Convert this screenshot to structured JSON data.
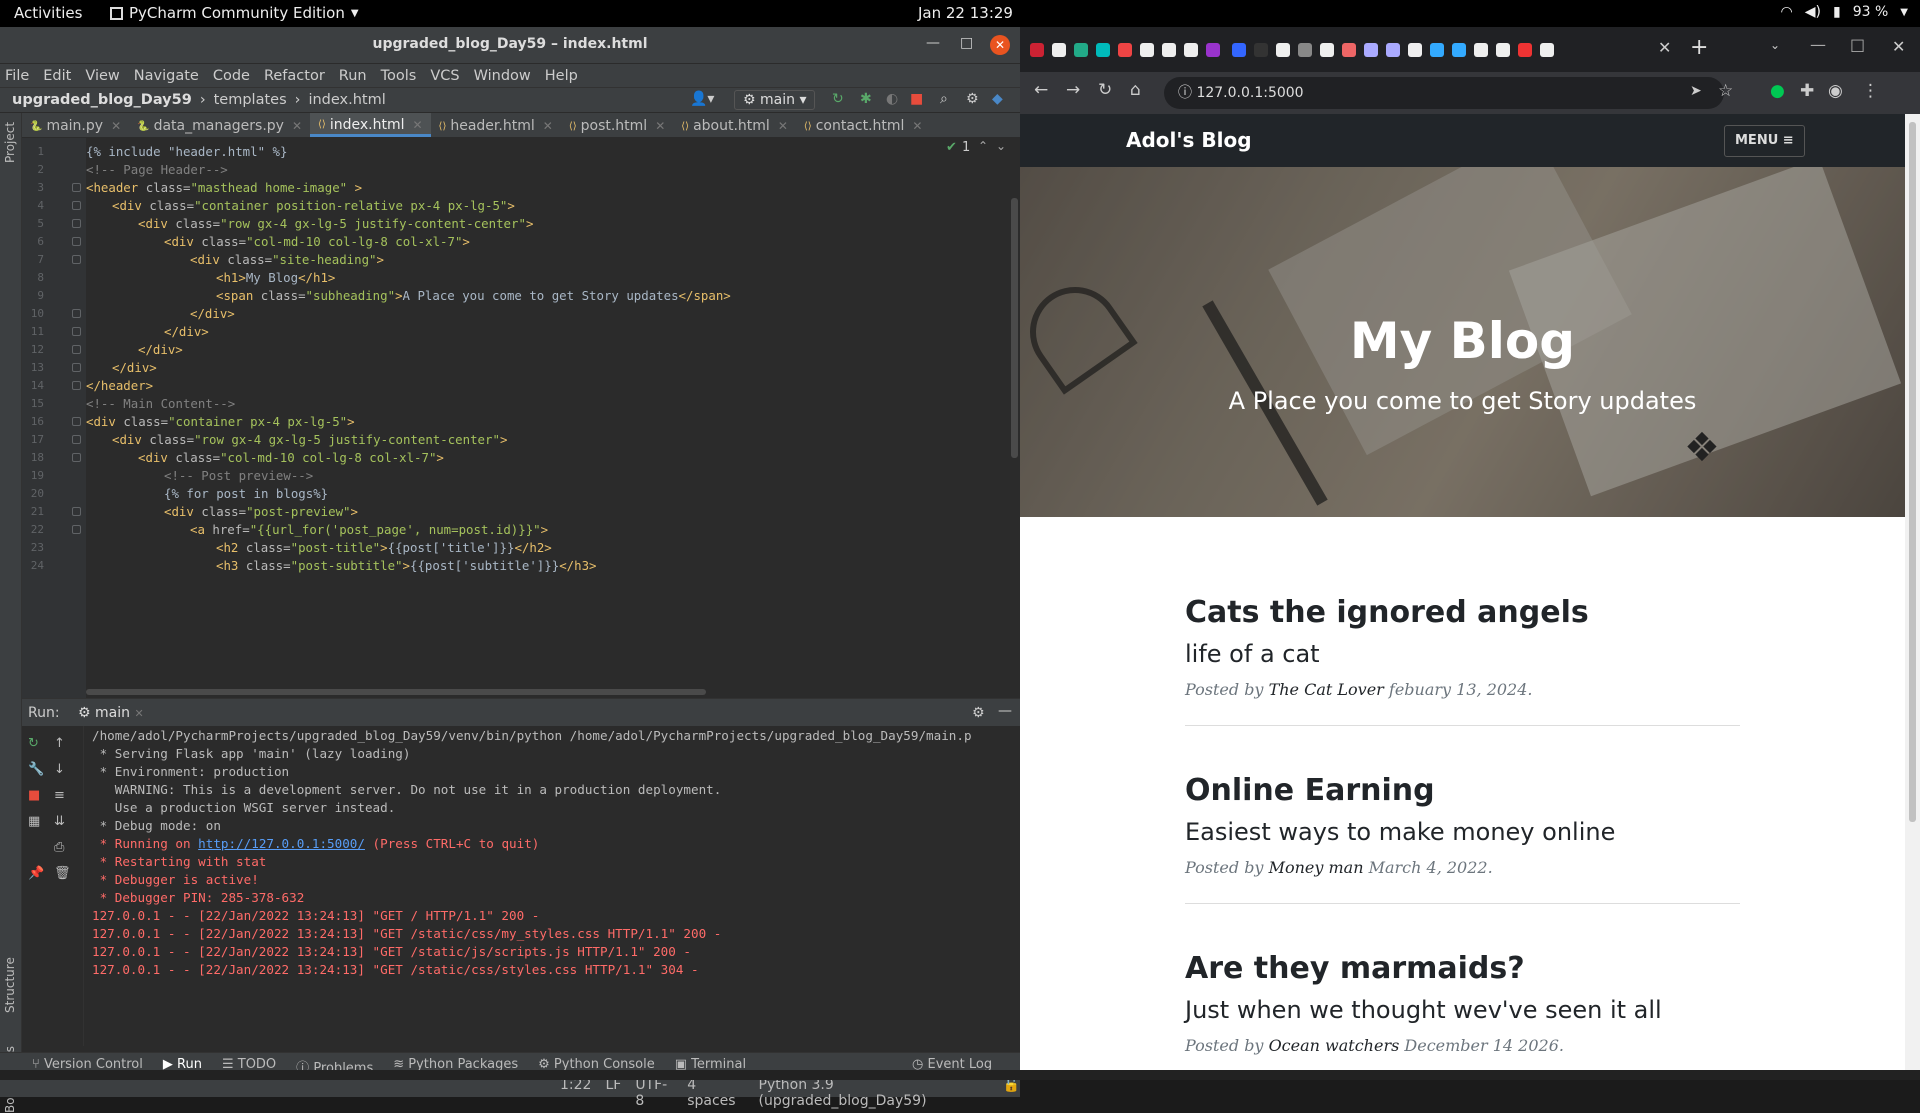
{
  "topbar": {
    "activities": "Activities",
    "app_name": "PyCharm Community Edition",
    "clock": "Jan 22  13:29",
    "battery": "93 %"
  },
  "pycharm": {
    "title": "upgraded_blog_Day59 – index.html",
    "menu": [
      "File",
      "Edit",
      "View",
      "Navigate",
      "Code",
      "Refactor",
      "Run",
      "Tools",
      "VCS",
      "Window",
      "Help"
    ],
    "breadcrumb": {
      "project": "upgraded_blog_Day59",
      "folder": "templates",
      "file": "index.html"
    },
    "branch": "main",
    "tabs": [
      "main.py",
      "data_managers.py",
      "index.html",
      "header.html",
      "post.html",
      "about.html",
      "contact.html"
    ],
    "active_tab": "index.html",
    "project_label": "Project",
    "inspection": "1",
    "code_lines": [
      {
        "n": "1",
        "indent": 0,
        "parts": [
          [
            "t",
            "{% include \"header.html\" %}"
          ]
        ]
      },
      {
        "n": "2",
        "indent": 2,
        "parts": [
          [
            "c",
            "<!-- Page Header-->"
          ]
        ]
      },
      {
        "n": "3",
        "indent": 2,
        "parts": [
          [
            "g",
            "<header "
          ],
          [
            "a",
            "class="
          ],
          [
            "s",
            "\"masthead home-image\""
          ],
          [
            "g",
            " >"
          ]
        ]
      },
      {
        "n": "4",
        "indent": 3,
        "parts": [
          [
            "g",
            "<div "
          ],
          [
            "a",
            "class="
          ],
          [
            "s",
            "\"container position-relative px-4 px-lg-5\""
          ],
          [
            "g",
            ">"
          ]
        ]
      },
      {
        "n": "5",
        "indent": 4,
        "parts": [
          [
            "g",
            "<div "
          ],
          [
            "a",
            "class="
          ],
          [
            "s",
            "\"row gx-4 gx-lg-5 justify-content-center\""
          ],
          [
            "g",
            ">"
          ]
        ]
      },
      {
        "n": "6",
        "indent": 5,
        "parts": [
          [
            "g",
            "<div "
          ],
          [
            "a",
            "class="
          ],
          [
            "s",
            "\"col-md-10 col-lg-8 col-xl-7\""
          ],
          [
            "g",
            ">"
          ]
        ]
      },
      {
        "n": "7",
        "indent": 6,
        "parts": [
          [
            "g",
            "<div "
          ],
          [
            "a",
            "class="
          ],
          [
            "s",
            "\"site-heading\""
          ],
          [
            "g",
            ">"
          ]
        ]
      },
      {
        "n": "8",
        "indent": 7,
        "parts": [
          [
            "g",
            "<h1>"
          ],
          [
            "t",
            "My Blog"
          ],
          [
            "g",
            "</h1>"
          ]
        ]
      },
      {
        "n": "9",
        "indent": 7,
        "parts": [
          [
            "g",
            "<span "
          ],
          [
            "a",
            "class="
          ],
          [
            "s",
            "\"subheading\""
          ],
          [
            "g",
            ">"
          ],
          [
            "t",
            "A Place you come to get Story updates"
          ],
          [
            "g",
            "</span>"
          ]
        ]
      },
      {
        "n": "10",
        "indent": 6,
        "parts": [
          [
            "g",
            "</div>"
          ]
        ]
      },
      {
        "n": "11",
        "indent": 5,
        "parts": [
          [
            "g",
            "</div>"
          ]
        ]
      },
      {
        "n": "12",
        "indent": 4,
        "parts": [
          [
            "g",
            "</div>"
          ]
        ]
      },
      {
        "n": "13",
        "indent": 3,
        "parts": [
          [
            "g",
            "</div>"
          ]
        ]
      },
      {
        "n": "14",
        "indent": 2,
        "parts": [
          [
            "g",
            "</header>"
          ]
        ]
      },
      {
        "n": "15",
        "indent": 2,
        "parts": [
          [
            "c",
            "<!-- Main Content-->"
          ]
        ]
      },
      {
        "n": "16",
        "indent": 2,
        "parts": [
          [
            "g",
            "<div "
          ],
          [
            "a",
            "class="
          ],
          [
            "s",
            "\"container px-4 px-lg-5\""
          ],
          [
            "g",
            ">"
          ]
        ]
      },
      {
        "n": "17",
        "indent": 3,
        "parts": [
          [
            "g",
            "<div "
          ],
          [
            "a",
            "class="
          ],
          [
            "s",
            "\"row gx-4 gx-lg-5 justify-content-center\""
          ],
          [
            "g",
            ">"
          ]
        ]
      },
      {
        "n": "18",
        "indent": 4,
        "parts": [
          [
            "g",
            "<div "
          ],
          [
            "a",
            "class="
          ],
          [
            "s",
            "\"col-md-10 col-lg-8 col-xl-7\""
          ],
          [
            "g",
            ">"
          ]
        ]
      },
      {
        "n": "19",
        "indent": 5,
        "parts": [
          [
            "c",
            "<!-- Post preview-->"
          ]
        ]
      },
      {
        "n": "20",
        "indent": 5,
        "parts": [
          [
            "t",
            "{% for post in blogs%}"
          ]
        ]
      },
      {
        "n": "21",
        "indent": 5,
        "parts": [
          [
            "g",
            "<div "
          ],
          [
            "a",
            "class="
          ],
          [
            "s",
            "\"post-preview\""
          ],
          [
            "g",
            ">"
          ]
        ]
      },
      {
        "n": "22",
        "indent": 6,
        "parts": [
          [
            "g",
            "<a "
          ],
          [
            "a",
            "href="
          ],
          [
            "s",
            "\"{{url_for('post_page', num=post.id)}}\""
          ],
          [
            "g",
            ">"
          ]
        ]
      },
      {
        "n": "23",
        "indent": 7,
        "parts": [
          [
            "g",
            "<h2 "
          ],
          [
            "a",
            "class="
          ],
          [
            "s",
            "\"post-title\""
          ],
          [
            "g",
            ">"
          ],
          [
            "t",
            "{{post['title']}}"
          ],
          [
            "g",
            "</h2>"
          ]
        ]
      },
      {
        "n": "24",
        "indent": 7,
        "parts": [
          [
            "g",
            "<h3 "
          ],
          [
            "a",
            "class="
          ],
          [
            "s",
            "\"post-subtitle\""
          ],
          [
            "g",
            ">"
          ],
          [
            "t",
            "{{post['subtitle']}}"
          ],
          [
            "g",
            "</h3>"
          ]
        ]
      }
    ],
    "run": {
      "label": "Run:",
      "config": "main",
      "lines": [
        {
          "text": "/home/adol/PycharmProjects/upgraded_blog_Day59/venv/bin/python /home/adol/PycharmProjects/upgraded_blog_Day59/main.p",
          "color": "#bbbbbb"
        },
        {
          "text": " * Serving Flask app 'main' (lazy loading)",
          "color": "#bbbbbb"
        },
        {
          "text": " * Environment: production",
          "color": "#bbbbbb"
        },
        {
          "text": "   WARNING: This is a development server. Do not use it in a production deployment.",
          "color": "#bbbbbb"
        },
        {
          "text": "   Use a production WSGI server instead.",
          "color": "#bbbbbb"
        },
        {
          "text": " * Debug mode: on",
          "color": "#bbbbbb"
        },
        {
          "text": " * Running on ",
          "color": "#ff6b68",
          "link": "http://127.0.0.1:5000/",
          "after": " (Press CTRL+C to quit)"
        },
        {
          "text": " * Restarting with stat",
          "color": "#ff6b68"
        },
        {
          "text": " * Debugger is active!",
          "color": "#ff6b68"
        },
        {
          "text": " * Debugger PIN: 285-378-632",
          "color": "#ff6b68"
        },
        {
          "text": "127.0.0.1 - - [22/Jan/2022 13:24:13] \"GET / HTTP/1.1\" 200 -",
          "color": "#ff6b68"
        },
        {
          "text": "127.0.0.1 - - [22/Jan/2022 13:24:13] \"GET /static/css/my_styles.css HTTP/1.1\" 200 -",
          "color": "#ff6b68"
        },
        {
          "text": "127.0.0.1 - - [22/Jan/2022 13:24:13] \"GET /static/js/scripts.js HTTP/1.1\" 200 -",
          "color": "#ff6b68"
        },
        {
          "text": "127.0.0.1 - - [22/Jan/2022 13:24:13] \"GET /static/css/styles.css HTTP/1.1\" 304 -",
          "color": "#ff6b68"
        }
      ]
    },
    "toolwindows": [
      "Version Control",
      "Run",
      "TODO",
      "Problems",
      "Python Packages",
      "Python Console",
      "Terminal"
    ],
    "event_log": "Event Log",
    "side_labels": [
      "Structure",
      "Bookmarks"
    ],
    "status": {
      "pos": "1:22",
      "sep": "LF",
      "enc": "UTF-8",
      "indent": "4 spaces",
      "interp": "Python 3.9 (upgraded_blog_Day59)"
    }
  },
  "chrome": {
    "url": "127.0.0.1:5000",
    "brand": "Adol's Blog",
    "menu": "MENU ≡",
    "hero_title": "My Blog",
    "hero_sub": "A Place you come to get Story updates",
    "posted_by": "Posted by",
    "posts": [
      {
        "title": "Cats the ignored angels",
        "subtitle": "life of a cat",
        "author": "The Cat Lover",
        "date": "febuary 13, 2024."
      },
      {
        "title": "Online Earning",
        "subtitle": "Easiest ways to make money online",
        "author": "Money man",
        "date": "March 4, 2022."
      },
      {
        "title": "Are they marmaids?",
        "subtitle": "Just when we thought wev've seen it all",
        "author": "Ocean watchers",
        "date": "December 14 2026."
      }
    ]
  }
}
